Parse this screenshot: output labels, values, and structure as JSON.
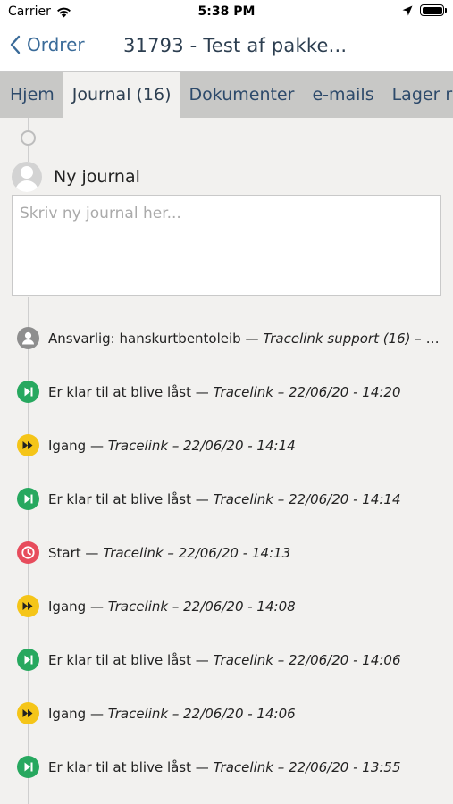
{
  "status_bar": {
    "carrier": "Carrier",
    "time": "5:38 PM"
  },
  "nav": {
    "back_label": "Ordrer",
    "title": "31793 - Test af pakke..."
  },
  "tabs": [
    {
      "label": "Hjem",
      "active": false
    },
    {
      "label": "Journal (16)",
      "active": true
    },
    {
      "label": "Dokumenter",
      "active": false
    },
    {
      "label": "e-mails",
      "active": false
    },
    {
      "label": "Lager r",
      "active": false
    }
  ],
  "new_journal": {
    "label": "Ny journal",
    "placeholder": "Skriv ny journal her..."
  },
  "entries": [
    {
      "icon": "person-icon",
      "color": "#8e8e8e",
      "title": "Ansvarlig: hanskurtbentoleib",
      "meta": "Tracelink support (16) – 14/..."
    },
    {
      "icon": "play-next-icon",
      "color": "#27a85f",
      "title": "Er klar til at blive låst",
      "meta": "Tracelink – 22/06/20 - 14:20"
    },
    {
      "icon": "fast-forward-icon",
      "color": "#f5c518",
      "title": "Igang",
      "meta": "Tracelink – 22/06/20 - 14:14"
    },
    {
      "icon": "play-next-icon",
      "color": "#27a85f",
      "title": "Er klar til at blive låst",
      "meta": "Tracelink – 22/06/20 - 14:14"
    },
    {
      "icon": "clock-icon",
      "color": "#e74c5c",
      "title": "Start",
      "meta": "Tracelink – 22/06/20 - 14:13"
    },
    {
      "icon": "fast-forward-icon",
      "color": "#f5c518",
      "title": "Igang",
      "meta": "Tracelink – 22/06/20 - 14:08"
    },
    {
      "icon": "play-next-icon",
      "color": "#27a85f",
      "title": "Er klar til at blive låst",
      "meta": "Tracelink – 22/06/20 - 14:06"
    },
    {
      "icon": "fast-forward-icon",
      "color": "#f5c518",
      "title": "Igang",
      "meta": "Tracelink – 22/06/20 - 14:06"
    },
    {
      "icon": "play-next-icon",
      "color": "#27a85f",
      "title": "Er klar til at blive låst",
      "meta": "Tracelink – 22/06/20 - 13:55"
    }
  ]
}
